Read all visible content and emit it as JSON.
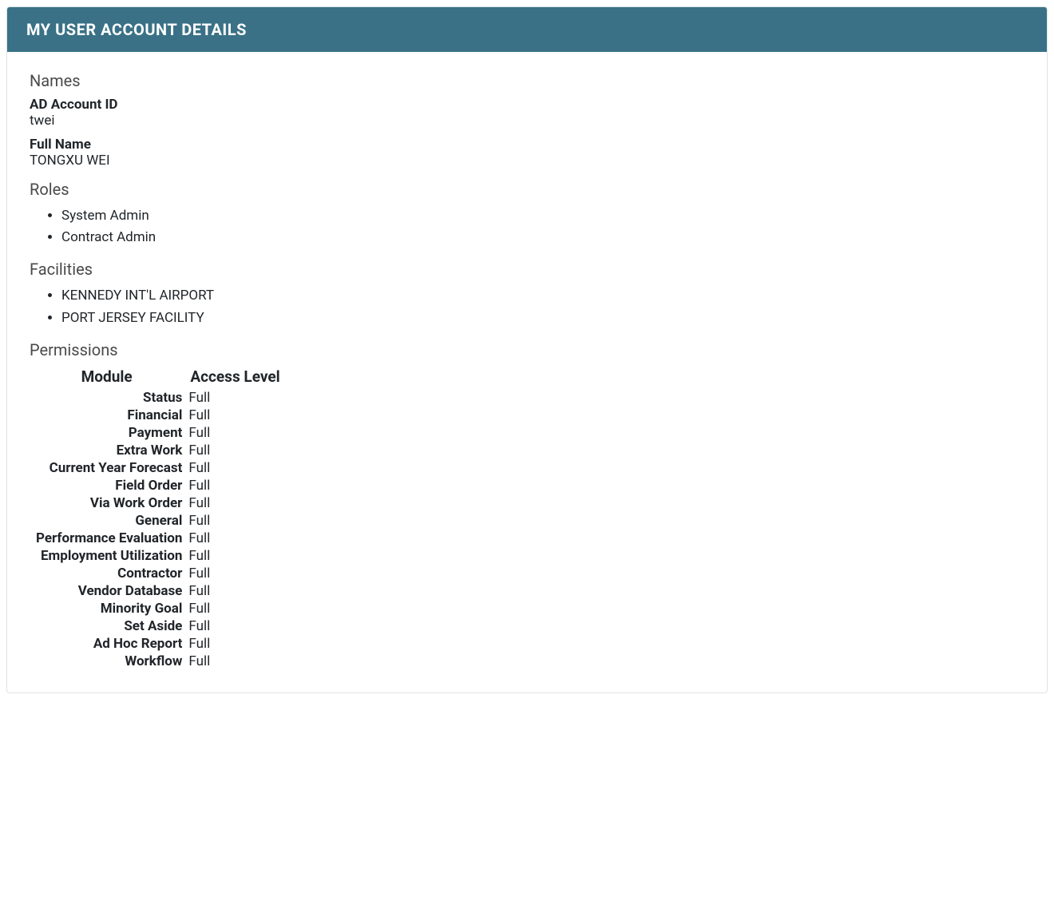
{
  "header": {
    "title": "MY USER ACCOUNT DETAILS"
  },
  "sections": {
    "names": {
      "label": "Names",
      "ad_account_id_label": "AD Account ID",
      "ad_account_id_value": "twei",
      "full_name_label": "Full Name",
      "full_name_value": "TONGXU WEI"
    },
    "roles": {
      "label": "Roles",
      "items": [
        "System Admin",
        "Contract Admin"
      ]
    },
    "facilities": {
      "label": "Facilities",
      "items": [
        "KENNEDY INT'L AIRPORT",
        "PORT JERSEY FACILITY"
      ]
    },
    "permissions": {
      "label": "Permissions",
      "columns": {
        "module": "Module",
        "access": "Access Level"
      },
      "rows": [
        {
          "module": "Status",
          "access": "Full"
        },
        {
          "module": "Financial",
          "access": "Full"
        },
        {
          "module": "Payment",
          "access": "Full"
        },
        {
          "module": "Extra Work",
          "access": "Full"
        },
        {
          "module": "Current Year Forecast",
          "access": "Full"
        },
        {
          "module": "Field Order",
          "access": "Full"
        },
        {
          "module": "Via Work Order",
          "access": "Full"
        },
        {
          "module": "General",
          "access": "Full"
        },
        {
          "module": "Performance Evaluation",
          "access": "Full"
        },
        {
          "module": "Employment Utilization",
          "access": "Full"
        },
        {
          "module": "Contractor",
          "access": "Full"
        },
        {
          "module": "Vendor Database",
          "access": "Full"
        },
        {
          "module": "Minority Goal",
          "access": "Full"
        },
        {
          "module": "Set Aside",
          "access": "Full"
        },
        {
          "module": "Ad Hoc Report",
          "access": "Full"
        },
        {
          "module": "Workflow",
          "access": "Full"
        }
      ]
    }
  }
}
